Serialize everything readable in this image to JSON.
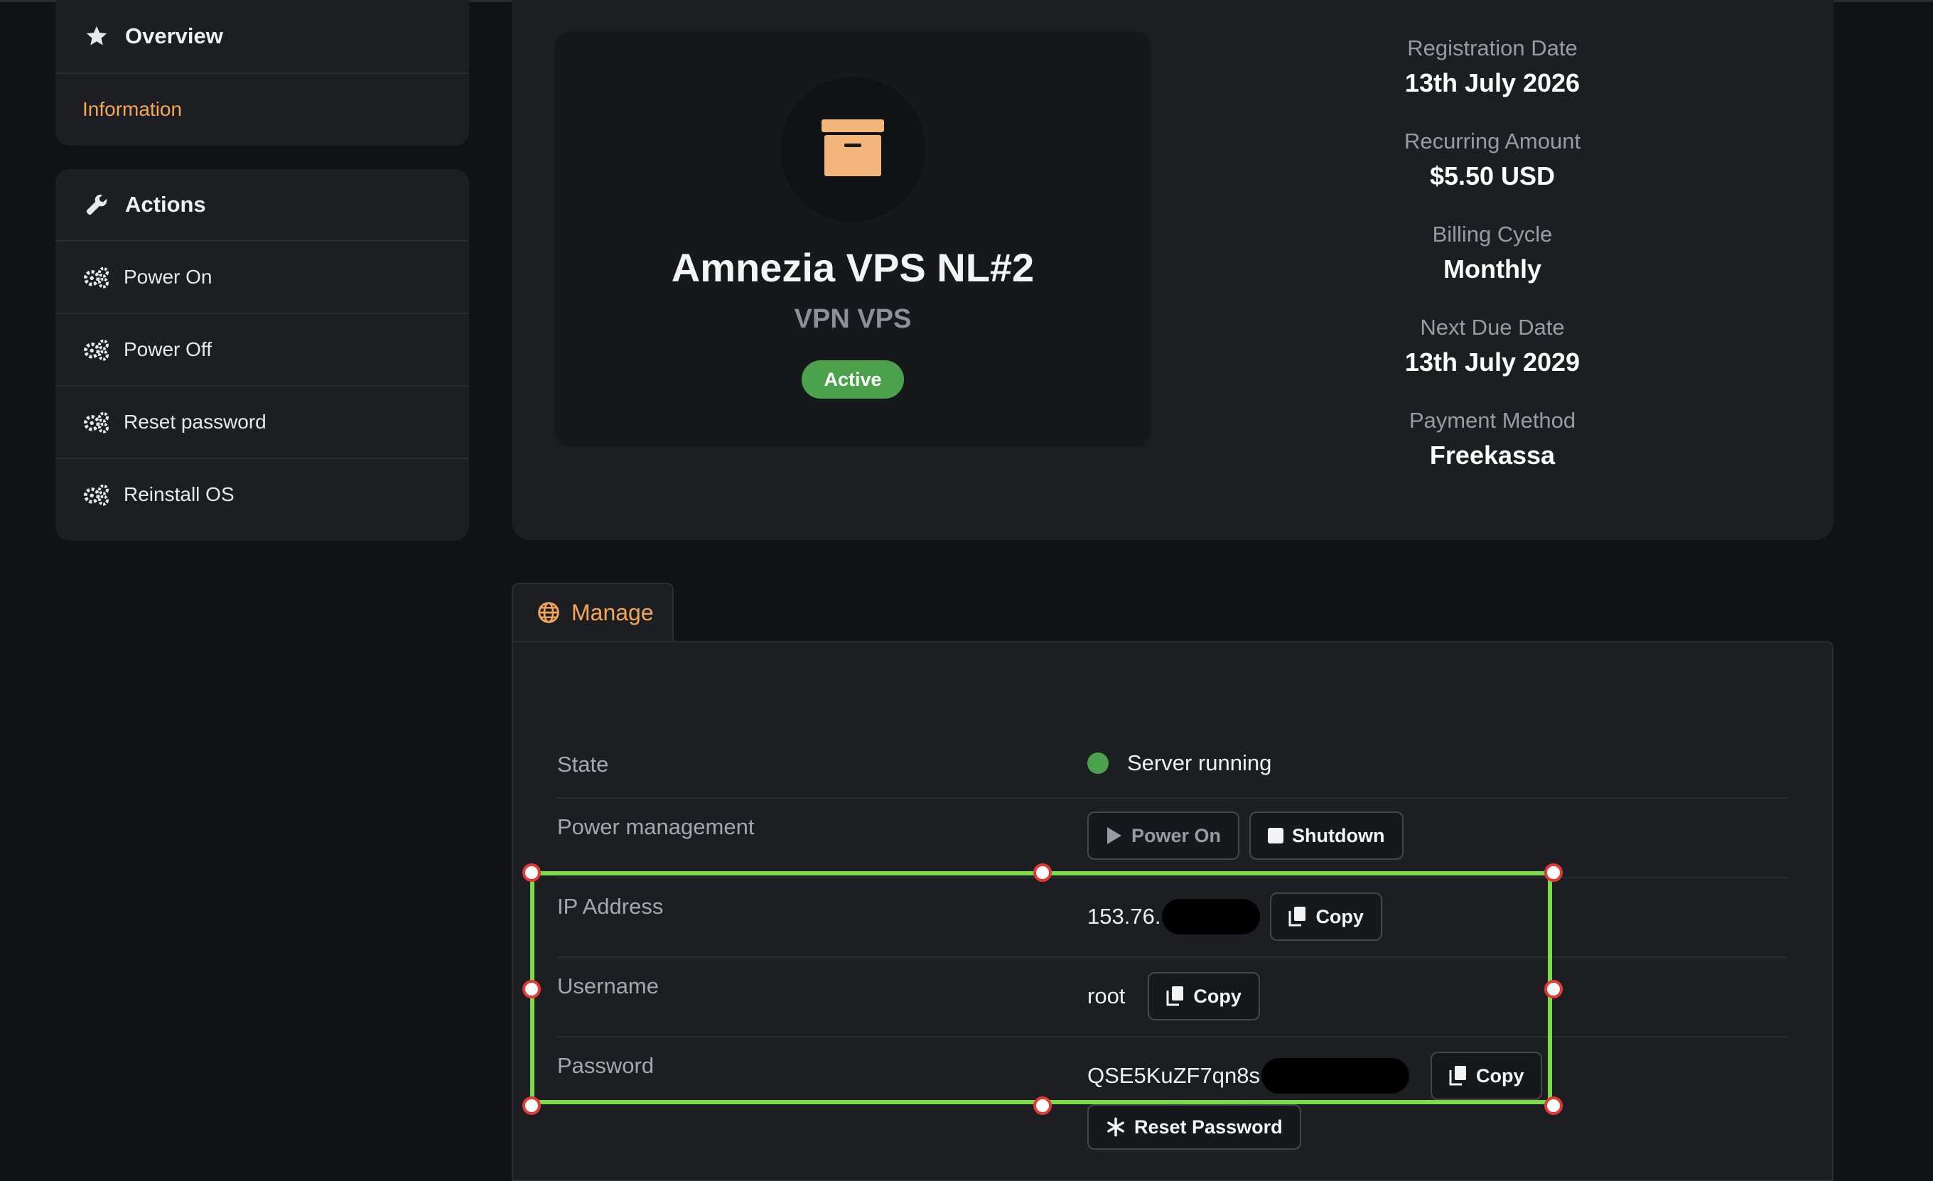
{
  "sidebar": {
    "overview": {
      "title": "Overview",
      "icon": "star-icon",
      "items": [
        {
          "label": "Information",
          "active": true
        }
      ]
    },
    "actions": {
      "title": "Actions",
      "icon": "wrench-icon",
      "items": [
        {
          "label": "Power On",
          "icon": "gears-icon"
        },
        {
          "label": "Power Off",
          "icon": "gears-icon"
        },
        {
          "label": "Reset password",
          "icon": "gears-icon"
        },
        {
          "label": "Reinstall OS",
          "icon": "gears-icon"
        }
      ]
    }
  },
  "product": {
    "icon": "archive-box-icon",
    "name": "Amnezia VPS NL#2",
    "group": "VPN VPS",
    "status": "Active"
  },
  "details": [
    {
      "label": "Registration Date",
      "value": "13th July 2026"
    },
    {
      "label": "Recurring Amount",
      "value": "$5.50 USD"
    },
    {
      "label": "Billing Cycle",
      "value": "Monthly"
    },
    {
      "label": "Next Due Date",
      "value": "13th July 2029"
    },
    {
      "label": "Payment Method",
      "value": "Freekassa"
    }
  ],
  "manage": {
    "tab_label": "Manage",
    "state_label": "State",
    "state_value": "Server running",
    "power_label": "Power management",
    "power_on_label": "Power On",
    "shutdown_label": "Shutdown",
    "ip_label": "IP Address",
    "ip_value": "153.76.",
    "username_label": "Username",
    "username_value": "root",
    "password_label": "Password",
    "password_value": "QSE5KuZF7qn8s",
    "copy_label": "Copy",
    "reset_password_label": "Reset Password"
  },
  "colors": {
    "accent": "#f3a55b",
    "success": "#4ca24c",
    "selection": "#7ddc4a",
    "handle": "#e53935"
  }
}
